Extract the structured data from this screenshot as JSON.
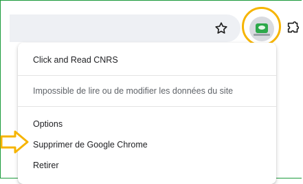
{
  "toolbar": {
    "bookmark_icon": "star-icon",
    "extension_icon": "click-and-read-icon",
    "extensions_menu_icon": "puzzle-icon"
  },
  "menu": {
    "title": "Click and Read CNRS",
    "permission_notice": "Impossible de lire ou de modifier les données du site",
    "items": [
      {
        "label": "Options"
      },
      {
        "label": "Supprimer de Google Chrome"
      },
      {
        "label": "Retirer"
      }
    ]
  },
  "annotations": {
    "highlight_color": "#f6b400",
    "arrow_color": "#f6b400"
  },
  "colors": {
    "frame": "#1a9a3a",
    "extension_brand": "#2da84a"
  }
}
